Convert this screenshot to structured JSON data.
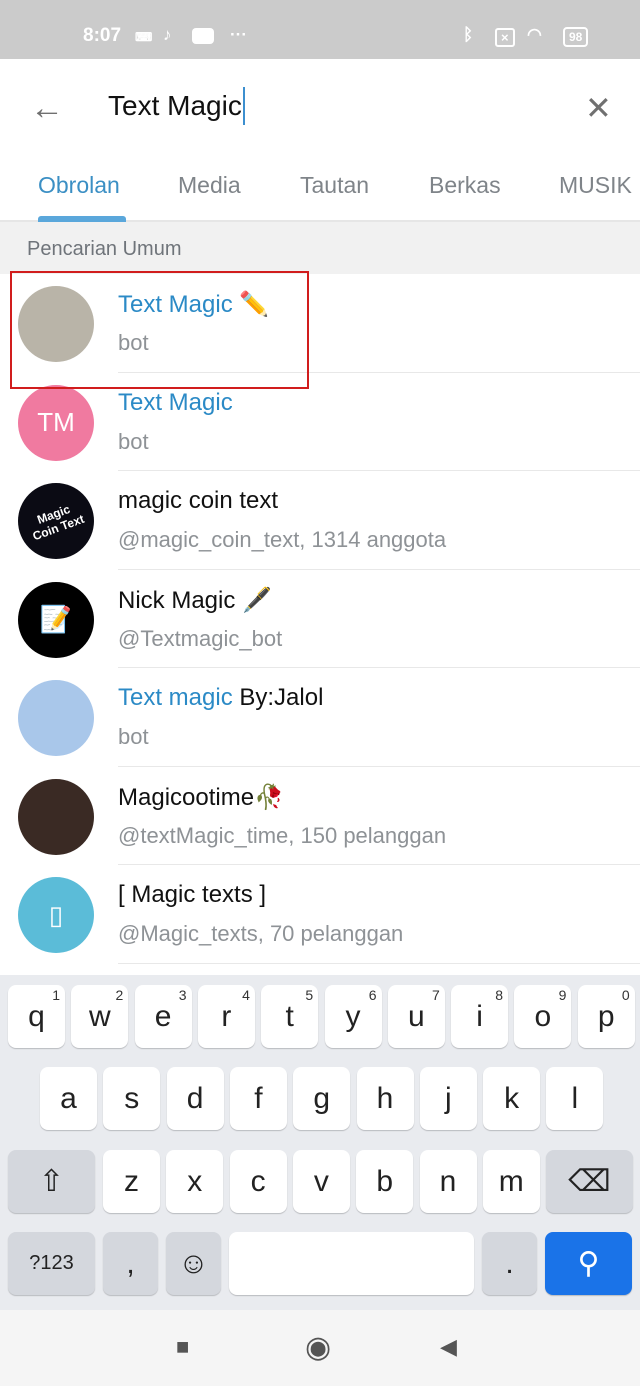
{
  "status_bar": {
    "time": "8:07",
    "battery": "98",
    "icons": [
      "keyboard-icon",
      "tiktok-icon",
      "youtube-icon",
      "more-dots-icon",
      "bluetooth-icon",
      "sim-icon",
      "wifi-icon",
      "battery-icon"
    ]
  },
  "search": {
    "value": "Text Magic"
  },
  "tabs": [
    "Obrolan",
    "Media",
    "Tautan",
    "Berkas",
    "MUSIK"
  ],
  "section_title": "Pencarian Umum",
  "results": [
    {
      "highlight": "Text Magic",
      "rest": " ✏️",
      "subtitle": "bot",
      "avatar_color": "#b9b4a8",
      "initials": ""
    },
    {
      "highlight": "Text Magic",
      "rest": "",
      "subtitle": "bot",
      "avatar_color": "#f07aa0",
      "initials": "TM"
    },
    {
      "highlight": "",
      "rest": "magic coin text",
      "subtitle": "@magic_coin_text, 1314 anggota",
      "avatar_color": "#0b0b14",
      "initials": "Magic Coin Text"
    },
    {
      "highlight": "",
      "rest": "Nick Magic 🖋️",
      "subtitle": "@Textmagic_bot",
      "avatar_color": "#000000",
      "initials": "📝"
    },
    {
      "highlight": "Text magic",
      "rest": " By:Jalol",
      "subtitle": "bot",
      "avatar_color": "#a9c7ea",
      "initials": ""
    },
    {
      "highlight": "",
      "rest": "Magicootime🥀",
      "subtitle": "@textMagic_time, 150  pelanggan",
      "avatar_color": "#3a2a24",
      "initials": ""
    },
    {
      "highlight": "",
      "rest": "[ Magic texts ]",
      "subtitle": "@Magic_texts, 70  pelanggan",
      "avatar_color": "#5bbcd8",
      "initials": "▯"
    }
  ],
  "keyboard": {
    "row1": [
      [
        "q",
        "1"
      ],
      [
        "w",
        "2"
      ],
      [
        "e",
        "3"
      ],
      [
        "r",
        "4"
      ],
      [
        "t",
        "5"
      ],
      [
        "y",
        "6"
      ],
      [
        "u",
        "7"
      ],
      [
        "i",
        "8"
      ],
      [
        "o",
        "9"
      ],
      [
        "p",
        "0"
      ]
    ],
    "row2": [
      "a",
      "s",
      "d",
      "f",
      "g",
      "h",
      "j",
      "k",
      "l"
    ],
    "row3": [
      "z",
      "x",
      "c",
      "v",
      "b",
      "n",
      "m"
    ],
    "shift": "⇧",
    "backspace": "⌫",
    "symbols": "?123",
    "comma": ",",
    "emoji": "☺",
    "period": ".",
    "search": "⚲"
  },
  "nav": {
    "recents": "■",
    "home": "◉",
    "back": "◀"
  },
  "colors": {
    "accent": "#3b8fc4",
    "highlight_border": "#d11d1d",
    "search_key": "#1a73e8"
  }
}
